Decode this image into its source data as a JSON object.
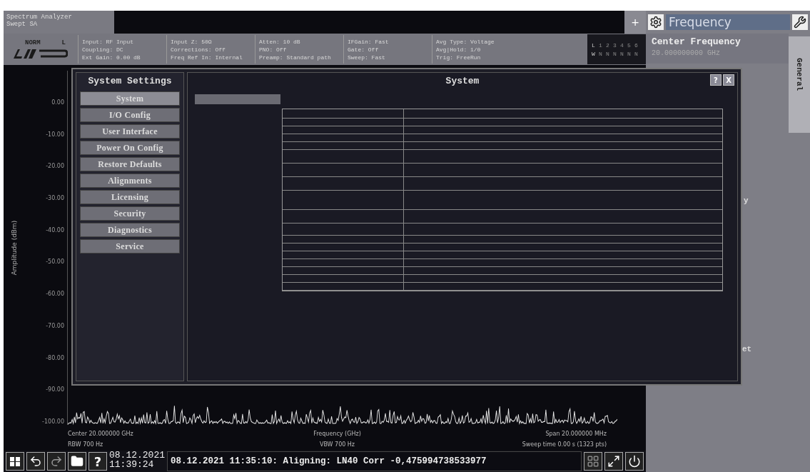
{
  "app_tab": {
    "title": "Spectrum Analyzer",
    "subtitle": "Swept SA"
  },
  "add_button": "+",
  "info_bar": {
    "mode": "NORM",
    "channel": "L",
    "groups": [
      [
        "Input: RF Input",
        "Coupling: DC",
        "Ext Gain: 0.00 dB"
      ],
      [
        "Input Z: 50Ω",
        "Corrections: Off",
        "Freq Ref In: Internal"
      ],
      [
        "Atten: 10 dB",
        "PNO: Off",
        "Preamp: Standard path"
      ],
      [
        "IFGain: Fast",
        "Gate: Off",
        "Sweep: Fast"
      ],
      [
        "Avg Type: Voltage",
        "Avg|Hold: 1/0",
        "Trig: FreeRun"
      ]
    ],
    "traces": {
      "numbers": [
        "L",
        "1",
        "2",
        "3",
        "4",
        "5",
        "6"
      ],
      "types": [
        "W",
        "N",
        "N",
        "N",
        "N",
        "N",
        "N"
      ]
    }
  },
  "plot": {
    "ylabel": "Amplitude (dBm)",
    "yticks": [
      "0.00",
      "-10.00",
      "-20.00",
      "-30.00",
      "-40.00",
      "-50.00",
      "-60.00",
      "-70.00",
      "-80.00",
      "-90.00",
      "-100.00"
    ],
    "center": "Center 20.000000 GHz",
    "xlabel": "Frequency (GHz)",
    "span": "Span 20.000000 MHz",
    "rbw": "RBW 700 Hz",
    "vbw": "VBW 700 Hz",
    "sweep": "Sweep time 0.00 s (1323 pts)"
  },
  "dialog": {
    "sidebar_title": "System Settings",
    "title": "System",
    "help": "?",
    "close": "X",
    "items": [
      {
        "label": "System",
        "selected": true
      },
      {
        "label": "I/O Config",
        "selected": false
      },
      {
        "label": "User Interface",
        "selected": false
      },
      {
        "label": "Power On Config",
        "selected": false
      },
      {
        "label": "Restore Defaults",
        "selected": false
      },
      {
        "label": "Alignments",
        "selected": false
      },
      {
        "label": "Licensing",
        "selected": false
      },
      {
        "label": "Security",
        "selected": false
      },
      {
        "label": "Diagnostics",
        "selected": false
      },
      {
        "label": "Service",
        "selected": false
      }
    ]
  },
  "right_panel": {
    "menu": "Frequency",
    "softkey_label": "Center Frequency",
    "softkey_value": "20.000000000 GHz",
    "side_tab": "General",
    "peek_1": "y",
    "peek_2": "et"
  },
  "taskbar": {
    "help": "?",
    "date": "08.12.2021",
    "time": "11:39:24",
    "message": "08.12.2021 11:35:10: Aligning: LN40 Corr -0,475994738533977"
  }
}
